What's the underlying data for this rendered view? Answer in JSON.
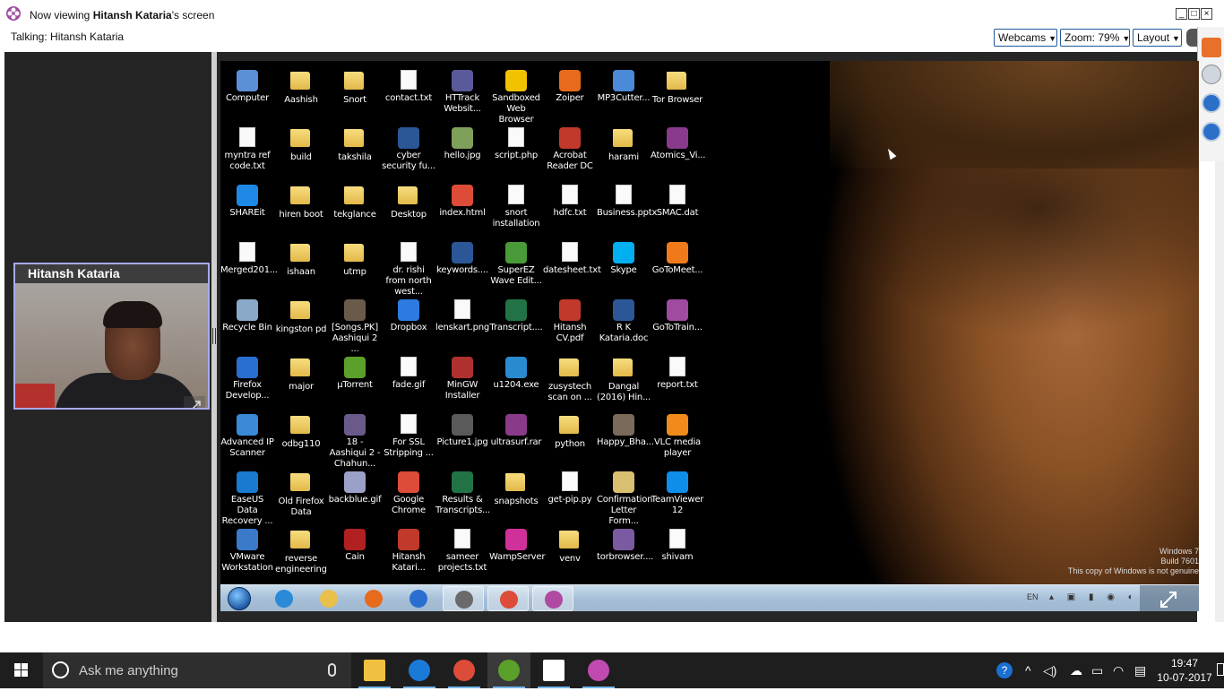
{
  "window": {
    "title_prefix": "Now viewing ",
    "title_name": "Hitansh Kataria",
    "title_suffix": "'s screen",
    "talking": "Talking: Hitansh Kataria",
    "webcams_label": "Webcams",
    "zoom_label": "Zoom: 79%",
    "layout_label": "Layout",
    "accent": "#1e5a9a"
  },
  "webcam": {
    "name": "Hitansh Kataria",
    "border_color": "#a9a9f0"
  },
  "remote_desktop": {
    "icons": [
      {
        "label": "Computer",
        "type": "app",
        "color": "#5b8fd6"
      },
      {
        "label": "Aashish",
        "type": "folder"
      },
      {
        "label": "Snort",
        "type": "folder"
      },
      {
        "label": "contact.txt",
        "type": "file"
      },
      {
        "label": "HTTrack Websit...",
        "type": "app",
        "color": "#5a5a9a"
      },
      {
        "label": "Sandboxed Web Browser",
        "type": "app",
        "color": "#f2c200"
      },
      {
        "label": "Zoiper",
        "type": "app",
        "color": "#e86a1c"
      },
      {
        "label": "MP3Cutter...",
        "type": "app",
        "color": "#4a8ad8"
      },
      {
        "label": "Tor Browser",
        "type": "folder"
      },
      {
        "label": "myntra ref code.txt",
        "type": "file"
      },
      {
        "label": "build",
        "type": "folder"
      },
      {
        "label": "takshila",
        "type": "folder"
      },
      {
        "label": "cyber security fu...",
        "type": "app",
        "color": "#2b5797"
      },
      {
        "label": "hello.jpg",
        "type": "app",
        "color": "#7fa05a"
      },
      {
        "label": "script.php",
        "type": "file"
      },
      {
        "label": "Acrobat Reader DC",
        "type": "app",
        "color": "#c0392b"
      },
      {
        "label": "harami",
        "type": "folder"
      },
      {
        "label": "Atomics_Vi...",
        "type": "app",
        "color": "#8a3a8a"
      },
      {
        "label": "SHAREit",
        "type": "app",
        "color": "#1e88e5"
      },
      {
        "label": "hiren boot",
        "type": "folder"
      },
      {
        "label": "tekglance",
        "type": "folder"
      },
      {
        "label": "Desktop",
        "type": "folder"
      },
      {
        "label": "index.html",
        "type": "app",
        "color": "#dd4b39"
      },
      {
        "label": "snort installation",
        "type": "file"
      },
      {
        "label": "hdfc.txt",
        "type": "file"
      },
      {
        "label": "Business.pptx",
        "type": "file"
      },
      {
        "label": "SMAC.dat",
        "type": "file"
      },
      {
        "label": "Merged201...",
        "type": "file"
      },
      {
        "label": "ishaan",
        "type": "folder"
      },
      {
        "label": "utmp",
        "type": "folder"
      },
      {
        "label": "dr. rishi from north west...",
        "type": "file"
      },
      {
        "label": "keywords....",
        "type": "app",
        "color": "#2b5797"
      },
      {
        "label": "SuperEZ Wave Edit...",
        "type": "app",
        "color": "#4a9a3a"
      },
      {
        "label": "datesheet.txt",
        "type": "file"
      },
      {
        "label": "Skype",
        "type": "app",
        "color": "#00aff0"
      },
      {
        "label": "GoToMeet...",
        "type": "app",
        "color": "#f07a1a"
      },
      {
        "label": "Recycle Bin",
        "type": "app",
        "color": "#8aa8c8"
      },
      {
        "label": "kingston pd",
        "type": "folder"
      },
      {
        "label": "[Songs.PK] Aashiqui 2 ...",
        "type": "app",
        "color": "#6a5a4a"
      },
      {
        "label": "Dropbox",
        "type": "app",
        "color": "#2d7be0"
      },
      {
        "label": "lenskart.png",
        "type": "file"
      },
      {
        "label": "Transcript....",
        "type": "app",
        "color": "#217346"
      },
      {
        "label": "Hitansh CV.pdf",
        "type": "app",
        "color": "#c0392b"
      },
      {
        "label": "R K Kataria.doc",
        "type": "app",
        "color": "#2b5797"
      },
      {
        "label": "GoToTrain...",
        "type": "app",
        "color": "#a04aa0"
      },
      {
        "label": "Firefox Develop...",
        "type": "app",
        "color": "#2a6fd0"
      },
      {
        "label": "major",
        "type": "folder"
      },
      {
        "label": "µTorrent",
        "type": "app",
        "color": "#5aa02a"
      },
      {
        "label": "fade.gif",
        "type": "file"
      },
      {
        "label": "MinGW Installer",
        "type": "app",
        "color": "#b03030"
      },
      {
        "label": "u1204.exe",
        "type": "app",
        "color": "#2a8ad0"
      },
      {
        "label": "zusystech scan on ...",
        "type": "folder"
      },
      {
        "label": "Dangal (2016) Hin...",
        "type": "folder"
      },
      {
        "label": "report.txt",
        "type": "file"
      },
      {
        "label": "Advanced IP Scanner",
        "type": "app",
        "color": "#3a8ad8"
      },
      {
        "label": "odbg110",
        "type": "folder"
      },
      {
        "label": "18 - Aashiqui 2 - Chahun...",
        "type": "app",
        "color": "#6a5a8a"
      },
      {
        "label": "For SSL Stripping ...",
        "type": "file"
      },
      {
        "label": "Picture1.jpg",
        "type": "app",
        "color": "#5a5a5a"
      },
      {
        "label": "ultrasurf.rar",
        "type": "app",
        "color": "#8a3a8a"
      },
      {
        "label": "python",
        "type": "folder"
      },
      {
        "label": "Happy_Bha...",
        "type": "app",
        "color": "#7a6a5a"
      },
      {
        "label": "VLC media player",
        "type": "app",
        "color": "#f08a1a"
      },
      {
        "label": "EaseUS Data Recovery ...",
        "type": "app",
        "color": "#1a7ad0"
      },
      {
        "label": "Old Firefox Data",
        "type": "folder"
      },
      {
        "label": "backblue.gif",
        "type": "app",
        "color": "#9aa0c8"
      },
      {
        "label": "Google Chrome",
        "type": "app",
        "color": "#dd4b39"
      },
      {
        "label": "Results & Transcripts...",
        "type": "app",
        "color": "#217346"
      },
      {
        "label": "snapshots",
        "type": "folder"
      },
      {
        "label": "get-pip.py",
        "type": "file"
      },
      {
        "label": "Confirmation Letter Form...",
        "type": "app",
        "color": "#d8c070"
      },
      {
        "label": "TeamViewer 12",
        "type": "app",
        "color": "#0e8ee9"
      },
      {
        "label": "VMware Workstation",
        "type": "app",
        "color": "#3a7ac8"
      },
      {
        "label": "reverse engineering",
        "type": "folder"
      },
      {
        "label": "Cain",
        "type": "app",
        "color": "#b02020"
      },
      {
        "label": "Hitansh Katari...",
        "type": "app",
        "color": "#c0392b"
      },
      {
        "label": "sameer projects.txt",
        "type": "file"
      },
      {
        "label": "WampServer",
        "type": "app",
        "color": "#d0309a"
      },
      {
        "label": "venv",
        "type": "folder"
      },
      {
        "label": "torbrowser....",
        "type": "app",
        "color": "#7a5aa0"
      },
      {
        "label": "shivam",
        "type": "file"
      }
    ],
    "watermark_line1": "Windows 7",
    "watermark_line2": "Build 7601",
    "watermark_line3": "This copy of Windows is not genuine",
    "taskbar_lang": "EN",
    "taskbar_apps": [
      {
        "name": "ie",
        "color": "#2a8ad8"
      },
      {
        "name": "explorer",
        "color": "#e8c04a"
      },
      {
        "name": "firefox",
        "color": "#e86a1c"
      },
      {
        "name": "firefox-dev",
        "color": "#2a6fd0"
      },
      {
        "name": "sublime",
        "color": "#6a6a6a"
      },
      {
        "name": "chrome",
        "color": "#dd4b39"
      },
      {
        "name": "gotomeeting",
        "color": "#b04aa0"
      }
    ]
  },
  "taskbar": {
    "search_placeholder": "Ask me anything",
    "time": "19:47",
    "date": "10-07-2017",
    "apps": [
      {
        "name": "file-explorer",
        "color": "#f0c040"
      },
      {
        "name": "edge",
        "color": "#1a7ad8"
      },
      {
        "name": "chrome",
        "color": "#dd4b39"
      },
      {
        "name": "u1204",
        "color": "#5aa02a"
      },
      {
        "name": "settings",
        "color": "#ffffff"
      },
      {
        "name": "gotomeeting",
        "color": "#c04ab0"
      }
    ]
  }
}
